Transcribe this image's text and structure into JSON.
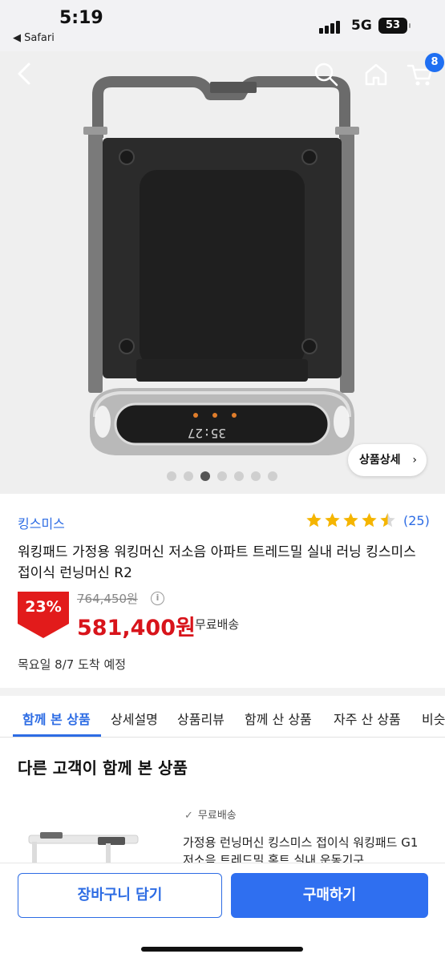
{
  "status_bar": {
    "time": "5:19",
    "back_app": "◀ Safari",
    "network": "5G",
    "battery": "53"
  },
  "header": {
    "cart_count": "8",
    "icons": [
      "back-arrow-icon",
      "search-icon",
      "home-icon",
      "cart-icon"
    ]
  },
  "gallery": {
    "detail_button": "상품상세",
    "detail_chevron": "›",
    "dot_count": 7,
    "active_dot": 3,
    "display_readout": "35:27"
  },
  "product": {
    "brand": "킹스미스",
    "rating": 4.5,
    "rating_count": "(25)",
    "title": "워킹패드 가정용 워킹머신 저소음 아파트 트레드밀 실내 러닝 킹스미스 접이식 런닝머신 R2",
    "discount": "23%",
    "original_price": "764,450원",
    "price": "581,400원",
    "shipping": "무료배송",
    "delivery": "목요일 8/7 도착 예정"
  },
  "tabs": [
    {
      "label": "함께 본 상품",
      "active": true
    },
    {
      "label": "상세설명",
      "active": false
    },
    {
      "label": "상품리뷰",
      "active": false
    },
    {
      "label": "함께 산 상품",
      "active": false
    },
    {
      "label": "자주 산 상품",
      "active": false
    },
    {
      "label": "비슷",
      "active": false
    }
  ],
  "section": {
    "title": "다른 고객이 함께 본 상품"
  },
  "recommended": [
    {
      "shipping": "무료배송",
      "title": "가정용 런닝머신 킹스미스 접이식 워킹패드 G1 저소음 트레드밀 홈트 실내 운동기구"
    }
  ],
  "actions": {
    "add_to_cart": "장바구니 담기",
    "buy_now": "구매하기"
  },
  "colors": {
    "accent": "#2d6ce4",
    "price_red": "#d8141b",
    "discount_badge": "#e21b1b",
    "star": "#f5b500"
  }
}
